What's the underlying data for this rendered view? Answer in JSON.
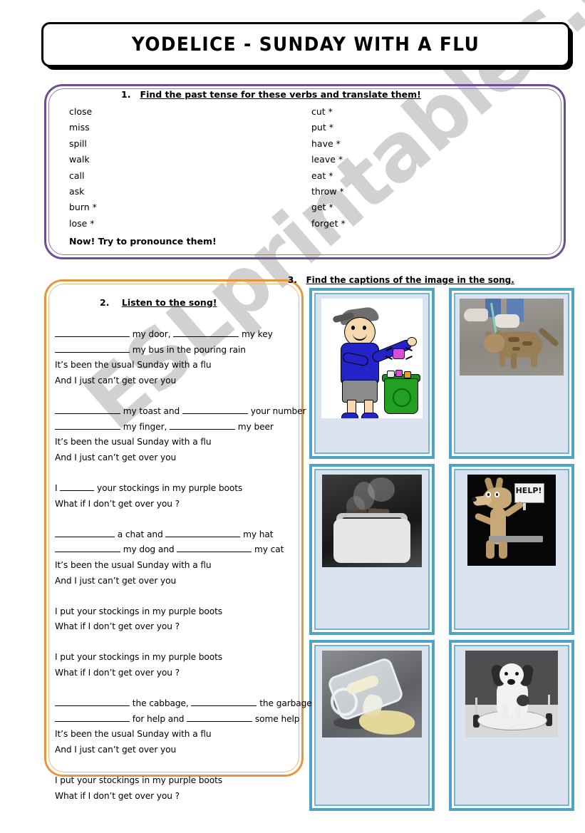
{
  "title": "YODELICE   - SUNDAY WITH A FLU",
  "watermark": "ESLprintables.com",
  "exercise1": {
    "number": "1.",
    "heading": "Find the past tense for these verbs and translate them!",
    "verbs_left": [
      "close",
      "miss",
      "spill",
      "walk",
      "call",
      "ask",
      "burn *",
      " lose *"
    ],
    "verbs_right": [
      "cut *",
      "put *",
      "have *",
      "leave *",
      "eat *",
      "throw *",
      "get *",
      "forget *"
    ],
    "footer": "Now! Try to pronounce them!"
  },
  "exercise2": {
    "number": "2.",
    "heading": "Listen to the song!",
    "lyrics": [
      {
        "type": "blanks",
        "parts": [
          {
            "blank": "xl"
          },
          {
            "text": " my door, "
          },
          {
            "blank": "lg"
          },
          {
            "text": " my key"
          }
        ]
      },
      {
        "type": "blanks",
        "parts": [
          {
            "blank": "xl"
          },
          {
            "text": " my bus in the pouring rain"
          }
        ]
      },
      {
        "type": "text",
        "text": "It’s been the usual Sunday with a flu"
      },
      {
        "type": "text",
        "text": "And I just can’t get over you"
      },
      {
        "type": "spacer"
      },
      {
        "type": "blanks",
        "parts": [
          {
            "blank": "lg"
          },
          {
            "text": " my toast and "
          },
          {
            "blank": "lg"
          },
          {
            "text": " your number"
          }
        ]
      },
      {
        "type": "blanks",
        "parts": [
          {
            "blank": "lg"
          },
          {
            "text": " my finger, "
          },
          {
            "blank": "lg"
          },
          {
            "text": " my beer"
          }
        ]
      },
      {
        "type": "text",
        "text": "It’s been the usual Sunday with a flu"
      },
      {
        "type": "text",
        "text": "And I just can’t get over you"
      },
      {
        "type": "spacer"
      },
      {
        "type": "blanks",
        "parts": [
          {
            "text": "I "
          },
          {
            "blank": "sm"
          },
          {
            "text": " your stockings in my purple boots"
          }
        ]
      },
      {
        "type": "text",
        "text": "What if I don’t get over you ?"
      },
      {
        "type": "spacer"
      },
      {
        "type": "blanks",
        "parts": [
          {
            "blank": "md"
          },
          {
            "text": " a chat and "
          },
          {
            "blank": "xl"
          },
          {
            "text": " my hat"
          }
        ]
      },
      {
        "type": "blanks",
        "parts": [
          {
            "blank": "lg"
          },
          {
            "text": " my dog and "
          },
          {
            "blank": "xl"
          },
          {
            "text": " my cat"
          }
        ]
      },
      {
        "type": "text",
        "text": "It’s been the usual Sunday with a flu"
      },
      {
        "type": "text",
        "text": "And I just can’t get over you"
      },
      {
        "type": "spacer"
      },
      {
        "type": "text",
        "text": "I put your stockings in my purple boots"
      },
      {
        "type": "text",
        "text": "What if I don’t get over you ?"
      },
      {
        "type": "spacer"
      },
      {
        "type": "text",
        "text": "I put your stockings in my purple boots"
      },
      {
        "type": "text",
        "text": "What if I don’t get over you ?"
      },
      {
        "type": "spacer"
      },
      {
        "type": "blanks",
        "parts": [
          {
            "blank": "xl"
          },
          {
            "text": " the cabbage, "
          },
          {
            "blank": "lg"
          },
          {
            "text": " the garbage"
          }
        ]
      },
      {
        "type": "blanks",
        "parts": [
          {
            "blank": "xl"
          },
          {
            "text": " for help and "
          },
          {
            "blank": "lg"
          },
          {
            "text": " some help"
          }
        ]
      },
      {
        "type": "text",
        "text": "It’s been the usual Sunday with a flu"
      },
      {
        "type": "text",
        "text": "And I just can’t get over you"
      },
      {
        "type": "spacer"
      },
      {
        "type": "text",
        "text": "I put your stockings in my purple boots"
      },
      {
        "type": "text",
        "text": "What if I don’t get over you ?"
      }
    ]
  },
  "exercise3": {
    "number": "3.",
    "heading": "Find the captions of the image in the song.",
    "images": [
      {
        "name": "boy-throwing-garbage",
        "alt": "Cartoon boy throwing a can into a green recycling bin"
      },
      {
        "name": "cat-on-leash",
        "alt": "Tabby cat walked on a leash on pavement"
      },
      {
        "name": "burnt-toast-toaster",
        "alt": "Toaster with smoking burnt toast"
      },
      {
        "name": "coyote-help-sign",
        "alt": "Cartoon coyote holding a HELP! sign"
      },
      {
        "name": "spilled-beer-mug",
        "alt": "Glass beer mug tipped over, beer spilled"
      },
      {
        "name": "dog-on-plate",
        "alt": "Dog sitting on a dinner plate with fork and knife"
      }
    ],
    "sign_label": "HELP!"
  },
  "colors": {
    "purple_border": "#6b4f91",
    "orange_border": "#e8963c",
    "teal_border": "#4fa3c4",
    "cell_fill": "#dce3f0",
    "watermark": "#c9c9c9"
  }
}
